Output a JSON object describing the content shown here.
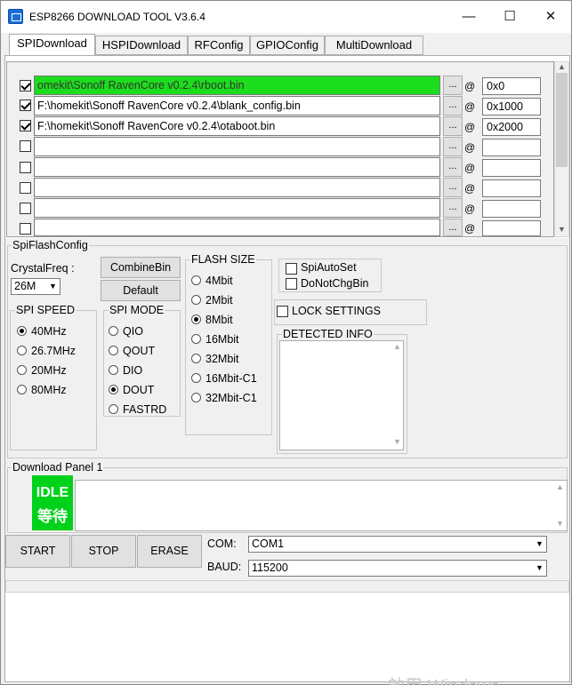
{
  "window": {
    "title": "ESP8266 DOWNLOAD TOOL V3.6.4",
    "minimize": "—",
    "maximize": "☐",
    "close": "✕"
  },
  "tabs": [
    "SPIDownload",
    "HSPIDownload",
    "RFConfig",
    "GPIOConfig",
    "MultiDownload"
  ],
  "files": [
    {
      "checked": true,
      "path": "omekit\\Sonoff RavenCore v0.2.4\\rboot.bin",
      "dots": "...",
      "at": "@",
      "addr": "0x0"
    },
    {
      "checked": true,
      "path": "F:\\homekit\\Sonoff RavenCore v0.2.4\\blank_config.bin",
      "dots": "...",
      "at": "@",
      "addr": "0x1000"
    },
    {
      "checked": true,
      "path": "F:\\homekit\\Sonoff RavenCore v0.2.4\\otaboot.bin",
      "dots": "...",
      "at": "@",
      "addr": "0x2000"
    },
    {
      "checked": false,
      "path": "",
      "dots": "...",
      "at": "@",
      "addr": ""
    },
    {
      "checked": false,
      "path": "",
      "dots": "...",
      "at": "@",
      "addr": ""
    },
    {
      "checked": false,
      "path": "",
      "dots": "...",
      "at": "@",
      "addr": ""
    },
    {
      "checked": false,
      "path": "",
      "dots": "...",
      "at": "@",
      "addr": ""
    },
    {
      "checked": false,
      "path": "",
      "dots": "...",
      "at": "@",
      "addr": ""
    }
  ],
  "spiflash": {
    "legend": "SpiFlashConfig",
    "crystal_label": "CrystalFreq :",
    "crystal_value": "26M",
    "combine_btn": "CombineBin",
    "default_btn": "Default",
    "spi_speed": {
      "legend": "SPI SPEED",
      "options": [
        "40MHz",
        "26.7MHz",
        "20MHz",
        "80MHz"
      ],
      "selected": 0
    },
    "spi_mode": {
      "legend": "SPI MODE",
      "options": [
        "QIO",
        "QOUT",
        "DIO",
        "DOUT",
        "FASTRD"
      ],
      "selected": 3
    },
    "flash_size": {
      "legend": "FLASH SIZE",
      "options": [
        "4Mbit",
        "2Mbit",
        "8Mbit",
        "16Mbit",
        "32Mbit",
        "16Mbit-C1",
        "32Mbit-C1"
      ],
      "selected": 2
    },
    "spi_auto_set": "SpiAutoSet",
    "do_not_chg_bin": "DoNotChgBin",
    "lock_settings": "LOCK SETTINGS",
    "detected_info": "DETECTED INFO"
  },
  "download_panel": {
    "legend": "Download Panel 1",
    "status_en": "IDLE",
    "status_zh": "等待",
    "start": "START",
    "stop": "STOP",
    "erase": "ERASE",
    "com_label": "COM:",
    "com_value": "COM1",
    "baud_label": "BAUD:",
    "baud_value": "115200"
  },
  "watermark": "啟用 Windows",
  "colors": {
    "selected_file": "#1cdd1c",
    "idle_status": "#00d11b"
  }
}
